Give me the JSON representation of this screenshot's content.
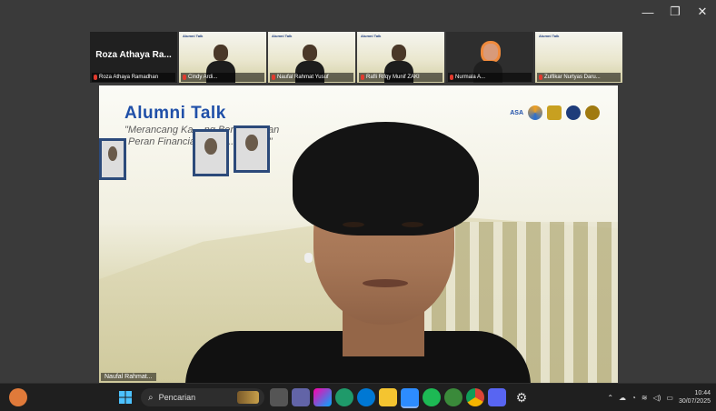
{
  "window": {
    "minimize": "—",
    "maximize": "❐",
    "close": "✕"
  },
  "participants": [
    {
      "big_name": "Roza Athaya Ra...",
      "label": "Roza Athaya Ramadhan",
      "kind": "name"
    },
    {
      "label": "Cindy Ardi...",
      "kind": "slide"
    },
    {
      "label": "Naufal Rahmat Yusuf",
      "kind": "slide"
    },
    {
      "label": "Rafli Rifqy Munif ZAKI",
      "kind": "slide"
    },
    {
      "label": "Nurmala A...",
      "kind": "pink"
    },
    {
      "label": "Zulfikar Nurtyas Daru...",
      "kind": "slide"
    }
  ],
  "slide": {
    "title": "Alumni  Talk",
    "subtitle_1": "\"Merancang Ka... ng Berkelanjutan",
    "subtitle_2": "Peran Financial Planni...  ...ESG\"",
    "tile_title": "Alumni Talk",
    "logo_text": "ASA"
  },
  "speaker": {
    "label": "Naufal Rahmat..."
  },
  "taskbar": {
    "search_placeholder": "Pencarian",
    "clock_time": "10:44",
    "clock_date": "30/07/2025"
  },
  "colors": {
    "slide_title": "#1f4fa8",
    "mic_muted": "#e23a2e",
    "taskbar": "#1f1f1f"
  }
}
